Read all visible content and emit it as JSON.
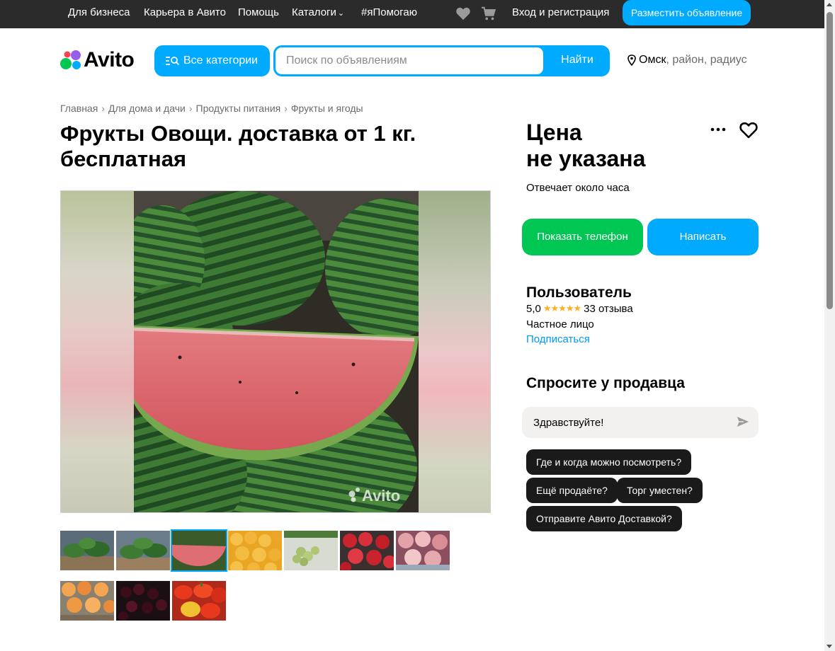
{
  "topbar": {
    "links": [
      "Для бизнеса",
      "Карьера в Авито",
      "Помощь",
      "Каталоги",
      "#яПомогаю"
    ],
    "login": "Вход и регистрация",
    "post_ad": "Разместить объявление"
  },
  "header": {
    "logo": "Avito",
    "categories_button": "Все категории",
    "search_placeholder": "Поиск по объявлениям",
    "search_button": "Найти",
    "location_city": "Омск",
    "location_extra": ", район, радиус"
  },
  "breadcrumb": [
    "Главная",
    "Для дома и дачи",
    "Продукты питания",
    "Фрукты и ягоды"
  ],
  "listing": {
    "title": "Фрукты Овощи. доставка от 1 кг. бесплатная",
    "watermark": "Avito",
    "thumbnails": [
      {
        "subject": "watermelons-stand"
      },
      {
        "subject": "watermelons-stand-2"
      },
      {
        "subject": "watermelon-slice",
        "active": true
      },
      {
        "subject": "apricots"
      },
      {
        "subject": "green-grapes"
      },
      {
        "subject": "strawberries"
      },
      {
        "subject": "peaches"
      },
      {
        "subject": "apricots-crate"
      },
      {
        "subject": "cherries"
      },
      {
        "subject": "peppers"
      }
    ]
  },
  "sidebar": {
    "price_line1": "Цена",
    "price_line2": "не указана",
    "reply_time": "Отвечает около часа",
    "show_phone": "Показать телефон",
    "write": "Написать",
    "seller_name": "Пользователь",
    "rating_value": "5,0",
    "rating_stars": "★★★★★",
    "reviews": "33 отзыва",
    "seller_type": "Частное лицо",
    "subscribe": "Подписаться",
    "ask_title": "Спросите у продавца",
    "message_value": "Здравствуйте!",
    "quick_questions": [
      "Где и когда можно посмотреть?",
      "Ещё продаёте?",
      "Торг уместен?",
      "Отправите Авито Доставкой?"
    ]
  },
  "colors": {
    "accent_blue": "#00aaff",
    "green": "#00c653",
    "topbar": "#2b2b2b",
    "link": "#0099f7",
    "star": "#ffb021"
  }
}
